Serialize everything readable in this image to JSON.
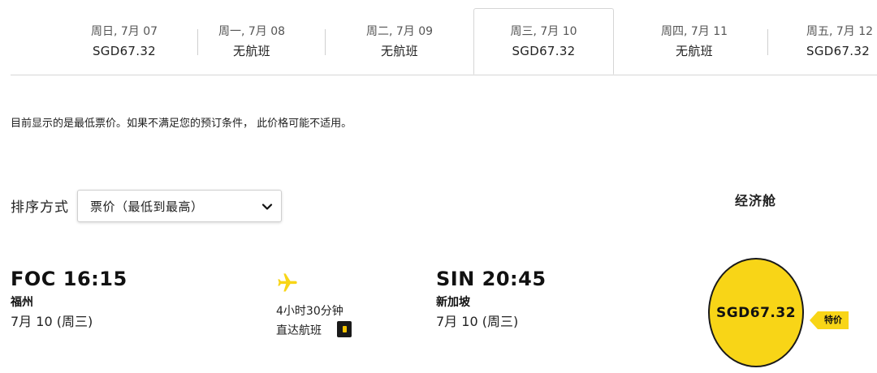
{
  "date_tabs": [
    {
      "day": "周日, 7月 07",
      "price": "SGD67.32"
    },
    {
      "day": "周一, 7月 08",
      "price": "无航班"
    },
    {
      "day": "周二, 7月 09",
      "price": "无航班"
    },
    {
      "day": "周三, 7月 10",
      "price": "SGD67.32"
    },
    {
      "day": "周四, 7月 11",
      "price": "无航班"
    },
    {
      "day": "周五, 7月 12",
      "price": "SGD67.32"
    }
  ],
  "notice": "目前显示的是最低票价。如果不满足您的预订条件， 此价格可能不适用。",
  "sort": {
    "label": "排序方式",
    "value": "票价（最低到最高）"
  },
  "cabin_header": "经济舱",
  "flight": {
    "departure": {
      "code_time": "FOC 16:15",
      "city": "福州",
      "date": "7月 10 (周三)"
    },
    "duration": "4小时30分钟",
    "type": "直达航班",
    "arrival": {
      "code_time": "SIN 20:45",
      "city": "新加坡",
      "date": "7月 10 (周三)"
    },
    "price": "SGD67.32",
    "promo": "特价"
  },
  "colors": {
    "accent": "#f8d517",
    "text": "#1a1a1a"
  }
}
